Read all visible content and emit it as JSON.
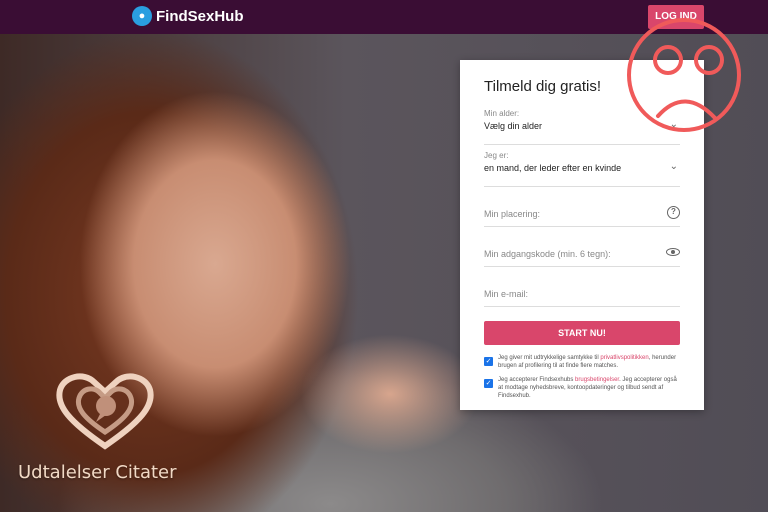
{
  "header": {
    "logo_text": "FindSexHub",
    "login_label": "LOG IND"
  },
  "form": {
    "title": "Tilmeld dig gratis!",
    "age_label": "Min alder:",
    "age_value": "Vælg din alder",
    "gender_label": "Jeg er:",
    "gender_value": "en mand, der leder efter en kvinde",
    "location_placeholder": "Min placering:",
    "password_placeholder": "Min adgangskode (min. 6 tegn):",
    "email_placeholder": "Min e-mail:",
    "submit_label": "START NU!",
    "consent1_pre": "Jeg giver mit udtrykkelige samtykke til ",
    "consent1_link": "privatlivspolitikken",
    "consent1_post": ", herunder brugen af profilering til at finde flere matches.",
    "consent2_pre": "Jeg accepterer Findsexhubs ",
    "consent2_link": "brugsbetingelser",
    "consent2_post": ". Jeg accepterer også at modtage nyhedsbreve, kontoopdateringer og tilbud sendt af Findsexhub."
  },
  "watermark": {
    "text": "Udtalelser Citater"
  },
  "icons": {
    "logo": "logo-icon",
    "chevron": "chevron-down-icon",
    "help": "question-icon",
    "eye": "eye-icon",
    "sad_face": "sad-face-icon",
    "heart": "heart-speech-icon",
    "checkbox": "checkmark-icon"
  },
  "colors": {
    "topbar": "#3a0d34",
    "accent": "#d9466b",
    "checkbox": "#1a73e8",
    "sad_face": "#f05a5a"
  }
}
